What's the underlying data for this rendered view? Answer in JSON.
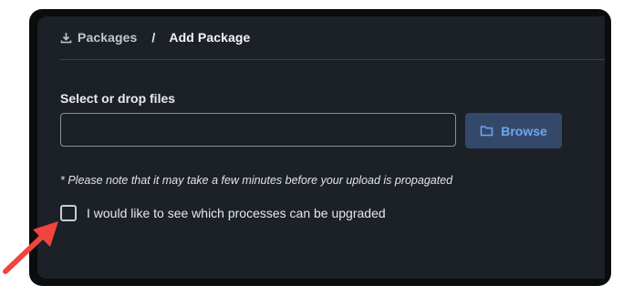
{
  "breadcrumb": {
    "icon": "download-icon",
    "parent_label": "Packages",
    "separator": "/",
    "current_label": "Add Package"
  },
  "upload": {
    "field_label": "Select or drop files",
    "input_value": "",
    "browse_icon": "folder-icon",
    "browse_label": "Browse"
  },
  "note": "* Please note that it may take a few minutes before your upload is propagated",
  "option": {
    "checked": false,
    "label": "I would like to see which processes can be upgraded"
  },
  "annotation": {
    "icon": "arrow-pointer-icon",
    "color": "#f0443f"
  },
  "colors": {
    "panel_background": "#1c2128",
    "frame_background": "#0b0c0e",
    "browse_button_background": "#34496a",
    "browse_button_text": "#6fa6ef"
  }
}
